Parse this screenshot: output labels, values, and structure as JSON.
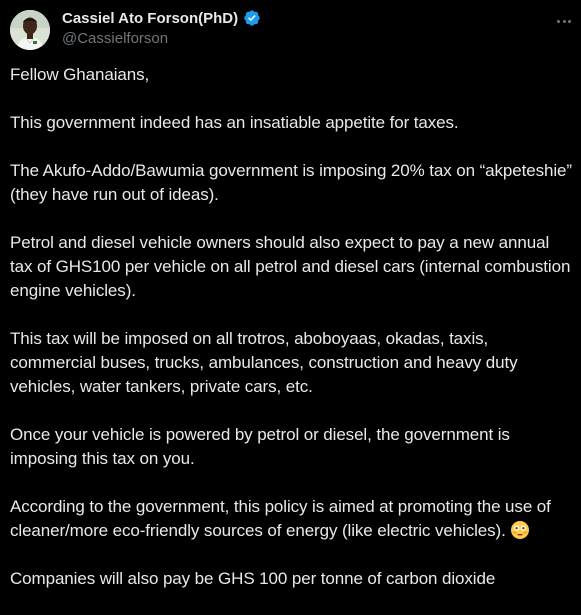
{
  "author": {
    "name": "Cassiel Ato Forson(PhD)",
    "handle": "@Cassielforson",
    "verified": true,
    "verified_color": "#1d9bf0"
  },
  "icons": {
    "avatar": "profile-photo",
    "verified": "verified-badge-icon",
    "more": "more-options-icon",
    "emoji": "flushed-face-emoji"
  },
  "tweet": {
    "paragraphs": [
      "Fellow Ghanaians,",
      "This government indeed has an insatiable appetite for taxes.",
      "The Akufo-Addo/Bawumia government is imposing 20% tax on “akpeteshie” (they have run out of ideas).",
      "Petrol and diesel vehicle owners should also expect to pay a new annual tax of GHS100 per vehicle on all petrol and diesel cars (internal combustion engine vehicles).",
      "This tax will be imposed on all trotros, aboboyaas, okadas, taxis, commercial buses, trucks, ambulances, construction and heavy duty vehicles, water tankers, private cars, etc.",
      "Once your vehicle is powered by petrol or diesel, the government is imposing this tax on you.",
      "According to the government, this policy is aimed at promoting the use of cleaner/more eco-friendly sources of energy (like electric vehicles).",
      "Companies will also pay be GHS 100 per tonne of carbon dioxide"
    ]
  },
  "colors": {
    "background": "#000000",
    "text": "#e7e9ea",
    "secondary_text": "#71767b"
  }
}
